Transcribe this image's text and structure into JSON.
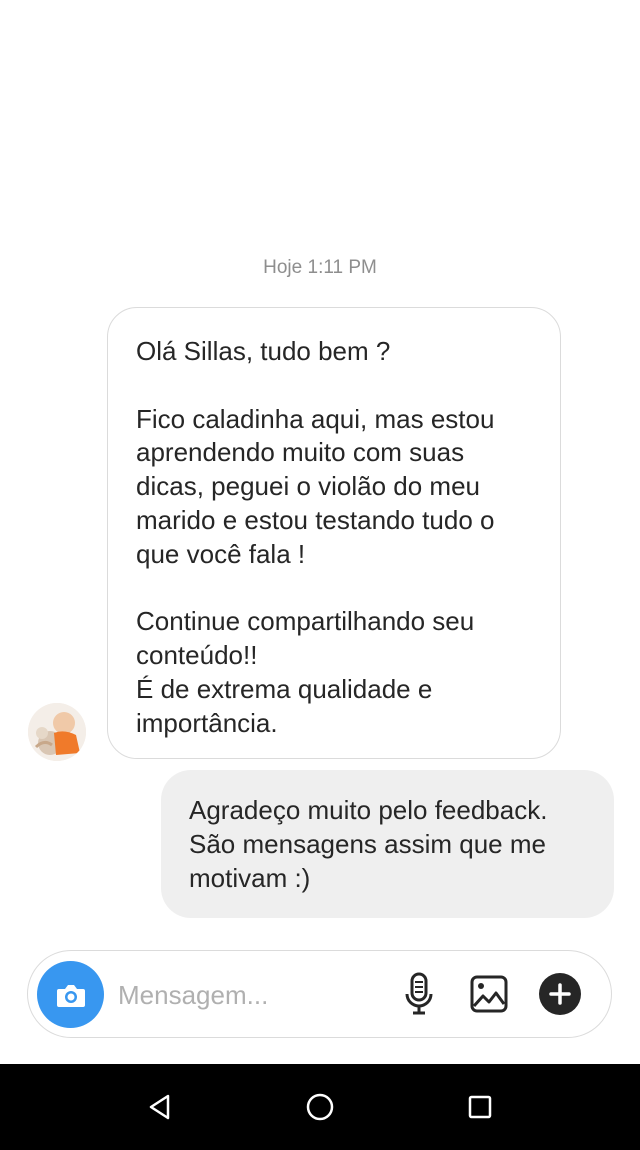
{
  "thread": {
    "timestamp": "Hoje 1:11 PM",
    "messages": [
      {
        "direction": "incoming",
        "text": "Olá Sillas, tudo bem ?\n\nFico caladinha aqui, mas estou\naprendendo muito com suas\ndicas, peguei o violão do meu\nmarido e estou testando tudo o\nque você fala !\n\nContinue compartilhando seu\nconteúdo!!\nÉ de extrema qualidade e\nimportância."
      },
      {
        "direction": "outgoing",
        "text": "Agradeço muito pelo feedback.\nSão mensagens assim que me\nmotivam :)"
      }
    ]
  },
  "composer": {
    "placeholder": "Mensagem...",
    "icons": [
      "camera-icon",
      "microphone-icon",
      "gallery-icon",
      "plus-icon"
    ]
  },
  "navbar": {
    "icons": [
      "back-icon",
      "home-icon",
      "recent-apps-icon"
    ]
  },
  "colors": {
    "accent": "#3897f0",
    "outgoing_bubble": "#efefef",
    "incoming_border": "#dbdbdb",
    "text": "#262626",
    "muted": "#8e8e8e",
    "navbar": "#000000"
  }
}
